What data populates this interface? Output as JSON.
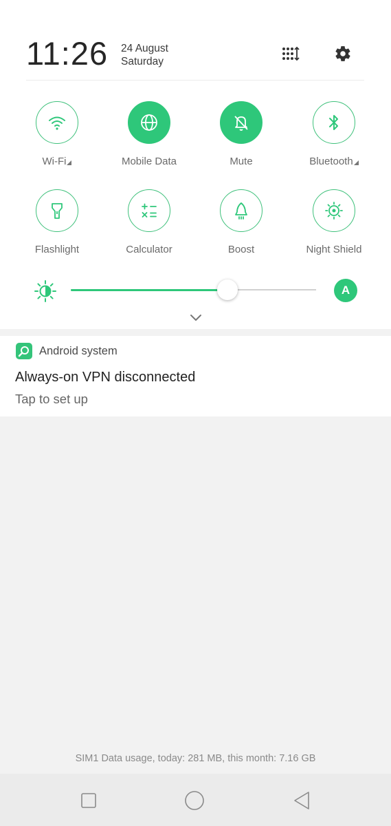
{
  "header": {
    "time": "11:26",
    "date": "24 August",
    "day": "Saturday",
    "edit_icon": "grid-sort-icon",
    "settings_icon": "gear-icon"
  },
  "tiles": [
    {
      "label": "Wi-Fi",
      "icon": "wifi-icon",
      "active": false,
      "has_arrow": true
    },
    {
      "label": "Mobile Data",
      "icon": "globe-icon",
      "active": true,
      "has_arrow": false
    },
    {
      "label": "Mute",
      "icon": "bell-mute-icon",
      "active": true,
      "has_arrow": false
    },
    {
      "label": "Bluetooth",
      "icon": "bluetooth-icon",
      "active": false,
      "has_arrow": true
    },
    {
      "label": "Flashlight",
      "icon": "flashlight-icon",
      "active": false,
      "has_arrow": false
    },
    {
      "label": "Calculator",
      "icon": "calculator-icon",
      "active": false,
      "has_arrow": false
    },
    {
      "label": "Boost",
      "icon": "rocket-icon",
      "active": false,
      "has_arrow": false
    },
    {
      "label": "Night Shield",
      "icon": "eye-shield-icon",
      "active": false,
      "has_arrow": false
    }
  ],
  "brightness": {
    "level": 0.64,
    "auto_label": "A"
  },
  "notification": {
    "app": "Android system",
    "title": "Always-on VPN disconnected",
    "text": "Tap to set up"
  },
  "data_usage": "SIM1 Data usage, today: 281 MB, this month: 7.16 GB",
  "colors": {
    "accent": "#2ec77a",
    "background": "#f2f2f2"
  }
}
